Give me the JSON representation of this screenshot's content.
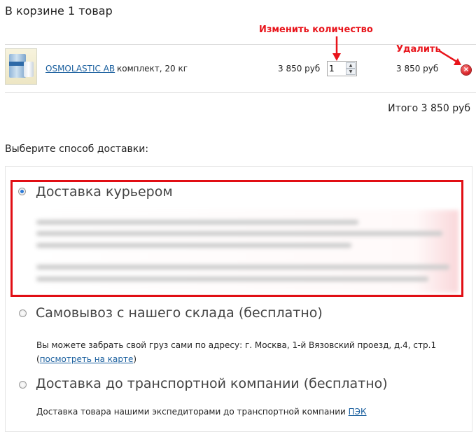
{
  "cart": {
    "title": "В корзине 1 товар",
    "item": {
      "name_link": "OSMOLASTIC AB",
      "description": "комплект, 20 кг",
      "unit_price": "3 850 руб",
      "quantity": "1",
      "line_total": "3 850 руб"
    },
    "total": "Итого 3 850 руб"
  },
  "annotations": {
    "change_quantity": "Изменить количество",
    "delete": "Удалить",
    "color": "#e8141b"
  },
  "delivery": {
    "title": "Выберите способ доставки:",
    "options": [
      {
        "label": "Доставка курьером",
        "selected": true
      },
      {
        "label": "Самовывоз с нашего склада (бесплатно)",
        "selected": false,
        "text_before": "Вы можете забрать свой груз сами по адресу: г. Москва, 1-й Вязовский проезд, д.4, стр.1",
        "paren_open": "(",
        "link": "посмотреть на карте",
        "paren_close": ")"
      },
      {
        "label": "Доставка до транспортной компании (бесплатно)",
        "selected": false,
        "text_before": "Доставка товара нашими экспедиторами до транспортной компании",
        "link": "ПЭК"
      }
    ]
  },
  "colors": {
    "link": "#1a5f9e",
    "highlight_frame": "#e10e14"
  },
  "icons": {
    "delete": "close-circle-icon",
    "spinner_up": "triangle-up-icon",
    "spinner_down": "triangle-down-icon"
  }
}
